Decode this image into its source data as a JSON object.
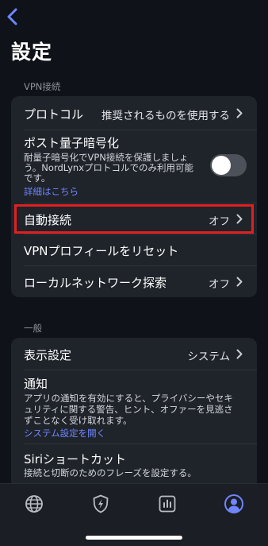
{
  "header": {
    "title": "設定"
  },
  "vpn_section": {
    "title": "VPN接続",
    "protocol": {
      "label": "プロトコル",
      "value": "推奨されるものを使用する"
    },
    "post_quantum": {
      "label": "ポスト量子暗号化",
      "desc_line1": "耐量子暗号化でVPN接続を保護しましょ",
      "desc_line2": "う。NordLynxプロトコルでのみ利用可能",
      "desc_line3": "です。",
      "link": "詳細はこちら",
      "toggle_on": false
    },
    "auto_connect": {
      "label": "自動接続",
      "value": "オフ"
    },
    "reset_profile": {
      "label": "VPNプロフィールをリセット"
    },
    "local_network": {
      "label": "ローカルネットワーク探索",
      "value": "オフ"
    }
  },
  "general_section": {
    "title": "一般",
    "display": {
      "label": "表示設定",
      "value": "システム"
    },
    "notifications": {
      "label": "通知",
      "desc_line1": "アプリの通知を有効にすると、プライバシーやセキ",
      "desc_line2": "ュリティに関する警告、ヒント、オファーを見逃さ",
      "desc_line3": "ずことなく受け取れます。",
      "link": "システム設定を開く"
    },
    "siri": {
      "label": "Siriショートカット",
      "desc": "接続と切断のためのフレーズを設定する。"
    }
  },
  "tabbar": {
    "tabs": [
      {
        "icon": "globe-icon",
        "active": false
      },
      {
        "icon": "shield-bolt-icon",
        "active": false
      },
      {
        "icon": "stats-icon",
        "active": false
      },
      {
        "icon": "profile-icon",
        "active": true
      }
    ]
  },
  "colors": {
    "accent": "#6f86ff",
    "highlight": "#e02020",
    "background": "#0f1218",
    "card": "#1f232a"
  }
}
